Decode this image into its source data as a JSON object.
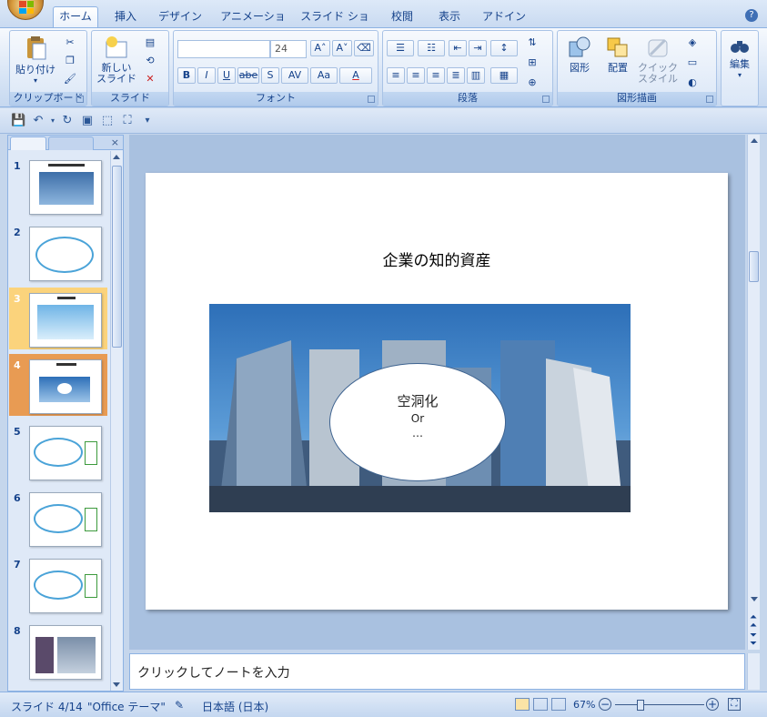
{
  "ribbon_tabs": [
    "ホーム",
    "挿入",
    "デザイン",
    "アニメーション",
    "スライド ショー",
    "校閲",
    "表示",
    "アドイン"
  ],
  "active_tab": "ホーム",
  "groups": {
    "clipboard": {
      "label": "クリップボード",
      "paste": "貼り付け"
    },
    "slides": {
      "label": "スライド",
      "new_slide_line1": "新しい",
      "new_slide_line2": "スライド"
    },
    "font": {
      "label": "フォント",
      "font_name": "",
      "font_size": "24"
    },
    "paragraph": {
      "label": "段落"
    },
    "drawing": {
      "label": "図形描画",
      "shapes": "図形",
      "arrange": "配置",
      "quick_styles_line1": "クイック",
      "quick_styles_line2": "スタイル"
    },
    "editing": {
      "label": "編集"
    }
  },
  "font_buttons": [
    "B",
    "I",
    "U",
    "abe",
    "S",
    "AV",
    "Aa",
    "A"
  ],
  "slides": [
    {
      "num": "1"
    },
    {
      "num": "2"
    },
    {
      "num": "3"
    },
    {
      "num": "4"
    },
    {
      "num": "5"
    },
    {
      "num": "6"
    },
    {
      "num": "7"
    },
    {
      "num": "8"
    }
  ],
  "current_slide": {
    "title": "企業の知的資産",
    "ellipse_line1": "空洞化",
    "ellipse_line2": "Or",
    "ellipse_line3": "…"
  },
  "notes_placeholder": "クリックしてノートを入力",
  "status": {
    "slide_indicator": "スライド 4/14",
    "theme": "\"Office テーマ\"",
    "language": "日本語 (日本)",
    "zoom": "67%"
  },
  "colors": {
    "selected_slide": "#e89b53",
    "hover_slide": "#fbd37c",
    "ribbon_text": "#15428b"
  }
}
